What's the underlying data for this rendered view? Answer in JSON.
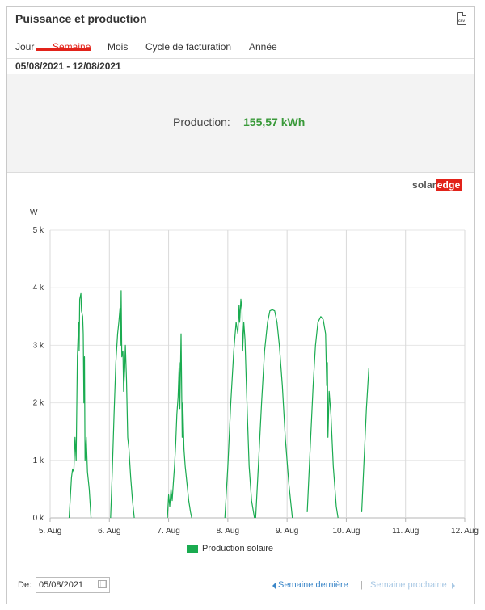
{
  "header": {
    "title": "Puissance et production",
    "csv_label": "CSV"
  },
  "tabs": [
    {
      "label": "Jour"
    },
    {
      "label": "Semaine"
    },
    {
      "label": "Mois"
    },
    {
      "label": "Cycle de facturation"
    },
    {
      "label": "Année"
    }
  ],
  "active_tab": "Semaine",
  "date_range": "05/08/2021 - 12/08/2021",
  "summary": {
    "label": "Production:",
    "value": "155,57 kWh"
  },
  "logo": {
    "part1": "solar",
    "part2": "edge"
  },
  "footer": {
    "date_label": "De:",
    "date_value": "05/08/2021",
    "prev_label": "Semaine dernière",
    "separator": "|",
    "next_label": "Semaine prochaine"
  },
  "colors": {
    "accent": "#e2231a",
    "series": "#1aab50",
    "value": "#3a9a3a",
    "link": "#3a86c8"
  },
  "chart_data": {
    "type": "line",
    "ylabel": "W",
    "ylim": [
      0,
      5000
    ],
    "yticks": [
      0,
      1000,
      2000,
      3000,
      4000,
      5000
    ],
    "ytick_labels": [
      "0 k",
      "1 k",
      "2 k",
      "3 k",
      "4 k",
      "5 k"
    ],
    "xlim": [
      0,
      7
    ],
    "xtick_labels": [
      "5. Aug",
      "6. Aug",
      "7. Aug",
      "8. Aug",
      "9. Aug",
      "10. Aug",
      "11. Aug",
      "12. Aug"
    ],
    "x_unit": "days since 5. Aug",
    "series": [
      {
        "name": "Production solaire",
        "segments": [
          [
            [
              0.32,
              0
            ],
            [
              0.36,
              700
            ],
            [
              0.38,
              850
            ],
            [
              0.4,
              800
            ],
            [
              0.42,
              1400
            ],
            [
              0.44,
              1000
            ],
            [
              0.46,
              2800
            ],
            [
              0.48,
              3400
            ],
            [
              0.49,
              2900
            ],
            [
              0.5,
              3800
            ],
            [
              0.52,
              3900
            ],
            [
              0.53,
              3600
            ],
            [
              0.55,
              3500
            ],
            [
              0.56,
              3200
            ],
            [
              0.57,
              2000
            ],
            [
              0.58,
              2800
            ],
            [
              0.59,
              1000
            ],
            [
              0.61,
              1400
            ],
            [
              0.63,
              800
            ],
            [
              0.66,
              500
            ],
            [
              0.69,
              0
            ]
          ],
          [
            [
              1.02,
              0
            ],
            [
              1.05,
              800
            ],
            [
              1.08,
              1800
            ],
            [
              1.11,
              2700
            ],
            [
              1.14,
              3200
            ],
            [
              1.16,
              3400
            ],
            [
              1.18,
              3650
            ],
            [
              1.19,
              3000
            ],
            [
              1.2,
              3950
            ],
            [
              1.21,
              2800
            ],
            [
              1.23,
              2900
            ],
            [
              1.24,
              2200
            ],
            [
              1.26,
              2600
            ],
            [
              1.27,
              3000
            ],
            [
              1.29,
              2400
            ],
            [
              1.31,
              1400
            ],
            [
              1.33,
              1200
            ],
            [
              1.36,
              700
            ],
            [
              1.39,
              300
            ],
            [
              1.42,
              0
            ]
          ],
          [
            [
              1.98,
              0
            ],
            [
              2.0,
              400
            ],
            [
              2.02,
              200
            ],
            [
              2.04,
              500
            ],
            [
              2.06,
              300
            ],
            [
              2.08,
              600
            ],
            [
              2.1,
              900
            ],
            [
              2.12,
              1300
            ],
            [
              2.14,
              1800
            ],
            [
              2.16,
              2100
            ],
            [
              2.18,
              2700
            ],
            [
              2.19,
              1900
            ],
            [
              2.21,
              3200
            ],
            [
              2.23,
              1400
            ],
            [
              2.24,
              2000
            ],
            [
              2.26,
              1200
            ],
            [
              2.28,
              900
            ],
            [
              2.31,
              600
            ],
            [
              2.34,
              300
            ],
            [
              2.37,
              100
            ],
            [
              2.39,
              0
            ]
          ],
          [
            [
              2.95,
              0
            ],
            [
              3.0,
              900
            ],
            [
              3.05,
              2000
            ],
            [
              3.1,
              2900
            ],
            [
              3.14,
              3400
            ],
            [
              3.17,
              3200
            ],
            [
              3.19,
              3700
            ],
            [
              3.2,
              3400
            ],
            [
              3.22,
              3800
            ],
            [
              3.24,
              3600
            ],
            [
              3.25,
              2900
            ],
            [
              3.27,
              3400
            ],
            [
              3.29,
              3100
            ],
            [
              3.31,
              2400
            ],
            [
              3.33,
              1800
            ],
            [
              3.36,
              900
            ],
            [
              3.4,
              300
            ],
            [
              3.45,
              0
            ]
          ],
          [
            [
              3.47,
              0
            ],
            [
              3.52,
              1000
            ],
            [
              3.57,
              2000
            ],
            [
              3.62,
              2900
            ],
            [
              3.67,
              3400
            ],
            [
              3.71,
              3600
            ],
            [
              3.75,
              3620
            ],
            [
              3.79,
              3600
            ],
            [
              3.83,
              3400
            ],
            [
              3.87,
              3000
            ],
            [
              3.92,
              2300
            ],
            [
              3.97,
              1400
            ],
            [
              4.03,
              600
            ],
            [
              4.09,
              0
            ]
          ],
          [
            [
              4.34,
              100
            ],
            [
              4.39,
              1200
            ],
            [
              4.44,
              2300
            ],
            [
              4.48,
              3000
            ],
            [
              4.52,
              3400
            ],
            [
              4.57,
              3500
            ],
            [
              4.61,
              3450
            ],
            [
              4.65,
              3200
            ],
            [
              4.67,
              2300
            ],
            [
              4.68,
              2700
            ],
            [
              4.69,
              1400
            ],
            [
              4.71,
              2200
            ],
            [
              4.74,
              1800
            ],
            [
              4.78,
              900
            ],
            [
              4.83,
              200
            ],
            [
              4.86,
              0
            ]
          ],
          [
            [
              5.26,
              100
            ],
            [
              5.3,
              1000
            ],
            [
              5.34,
              1900
            ],
            [
              5.38,
              2600
            ]
          ]
        ]
      }
    ],
    "legend": {
      "placement": "bottom-center",
      "entries": [
        "Production solaire"
      ]
    },
    "grid": true
  }
}
